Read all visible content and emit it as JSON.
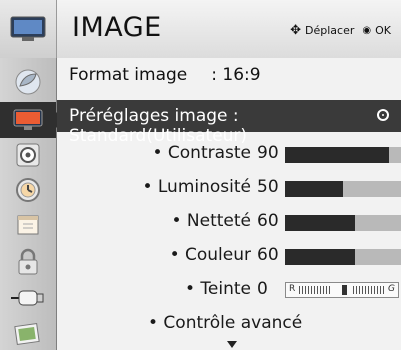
{
  "header": {
    "title": "IMAGE",
    "hint_move": "Déplacer",
    "hint_ok": "OK"
  },
  "sidebar": {
    "items": [
      {
        "icon": "satellite-dish-icon"
      },
      {
        "icon": "tv-picture-icon",
        "active": true
      },
      {
        "icon": "speaker-icon"
      },
      {
        "icon": "clock-icon"
      },
      {
        "icon": "calendar-icon"
      },
      {
        "icon": "lock-icon"
      },
      {
        "icon": "connector-icon"
      },
      {
        "icon": "photo-icon"
      }
    ]
  },
  "menu": {
    "format": {
      "label": "Format image",
      "value": ": 16:9"
    },
    "preset": {
      "label": "Préréglages image : Standard(Utilisateur)"
    },
    "settings": [
      {
        "label": "• Contraste",
        "value": "90",
        "level": 0.9
      },
      {
        "label": "• Luminosité",
        "value": "50",
        "level": 0.5
      },
      {
        "label": "• Netteté",
        "value": "60",
        "level": 0.6
      },
      {
        "label": "• Couleur",
        "value": "60",
        "level": 0.6
      }
    ],
    "tint": {
      "label": "• Teinte",
      "value": "0",
      "left_letter": "R",
      "right_letter": "G",
      "level": 0.5
    },
    "advanced": "• Contrôle avancé"
  },
  "colors": {
    "highlight": "#3a3a3a",
    "bar_fill": "#2a2a2a",
    "bar_bg": "#b9b9b9"
  }
}
